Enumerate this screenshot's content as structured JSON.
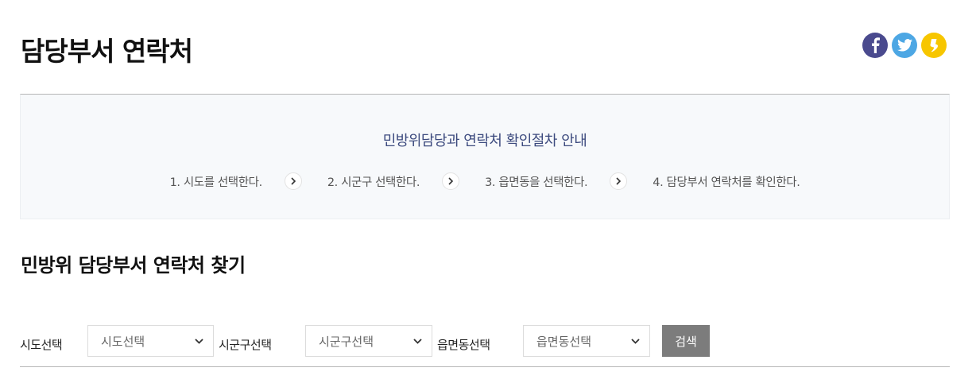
{
  "page": {
    "title": "담당부서 연락처"
  },
  "share": [
    {
      "name": "facebook",
      "icon": "facebook-icon",
      "color": "#4a4a8e"
    },
    {
      "name": "twitter",
      "icon": "twitter-icon",
      "color": "#4da7e4"
    },
    {
      "name": "kakaostory",
      "icon": "kakaostory-icon",
      "color": "#f7c600"
    }
  ],
  "guide": {
    "title": "민방위담당과 연락처 확인절차 안내",
    "steps": [
      "1. 시도를 선택한다.",
      "2. 시군구 선택한다.",
      "3. 읍면동을 선택한다.",
      "4. 담당부서 연락처를 확인한다."
    ]
  },
  "search": {
    "title": "민방위 담당부서 연락처 찾기",
    "sido": {
      "label": "시도선택",
      "value": "시도선택"
    },
    "sigungu": {
      "label": "시군구선택",
      "value": "시군구선택"
    },
    "eupmyeondong": {
      "label": "읍면동선택",
      "value": "읍면동선택"
    },
    "button": "검색"
  }
}
